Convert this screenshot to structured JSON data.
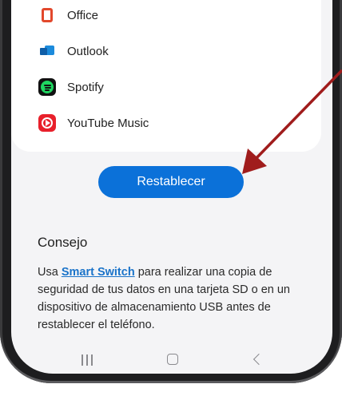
{
  "apps": [
    {
      "label": "Office",
      "icon": "office-icon"
    },
    {
      "label": "Outlook",
      "icon": "outlook-icon"
    },
    {
      "label": "Spotify",
      "icon": "spotify-icon"
    },
    {
      "label": "YouTube Music",
      "icon": "youtube-music-icon"
    }
  ],
  "reset_button": {
    "label": "Restablecer"
  },
  "tip": {
    "title": "Consejo",
    "text_before": "Usa ",
    "link": "Smart Switch",
    "text_after": " para realizar una copia de seguridad de tus datos en una tarjeta SD o en un dispositivo de almacenamiento USB antes de restablecer el teléfono."
  },
  "colors": {
    "accent": "#0b71d9",
    "link": "#1a73c9",
    "arrow": "#a01c1c"
  },
  "navigation": {
    "recents_icon": "recents-icon",
    "home_icon": "home-icon",
    "back_icon": "back-icon"
  }
}
